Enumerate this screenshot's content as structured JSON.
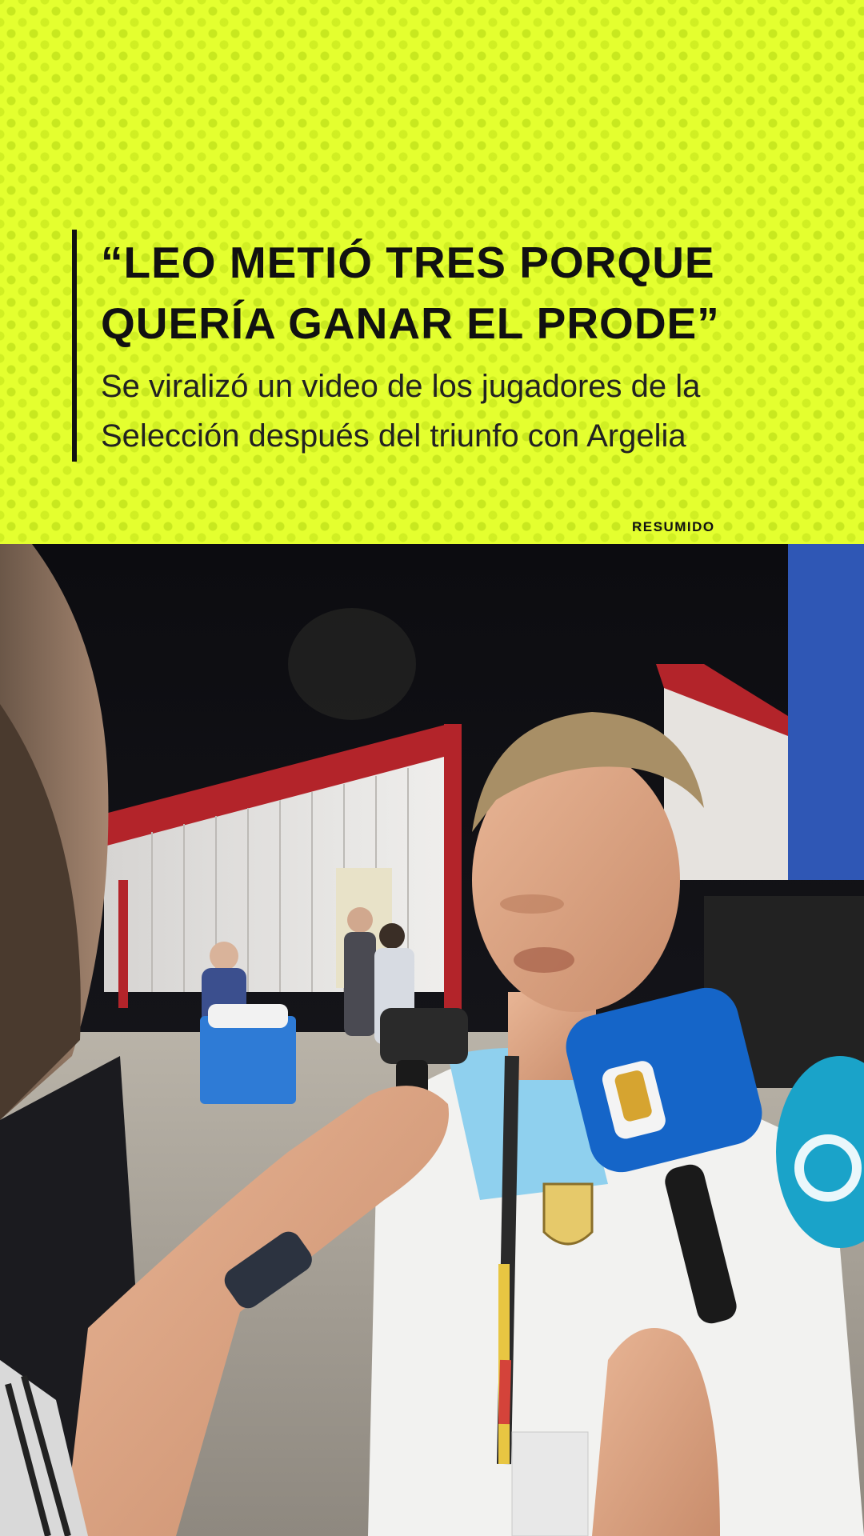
{
  "post": {
    "headline_lines": [
      "“LEO METIÓ TRES PORQUE",
      "QUERÍA GANAR EL PRODE”"
    ],
    "subheadline_lines": [
      "Se viralizó un video de los jugadores de la",
      "Selección después del triunfo con Argelia"
    ],
    "brand": "RESUMIDO"
  },
  "colors": {
    "header_background": "#e4ff2f",
    "text": "#111111",
    "microphone_blue": "#1565c8"
  },
  "photo": {
    "description_icon": "video-frame-photo"
  }
}
